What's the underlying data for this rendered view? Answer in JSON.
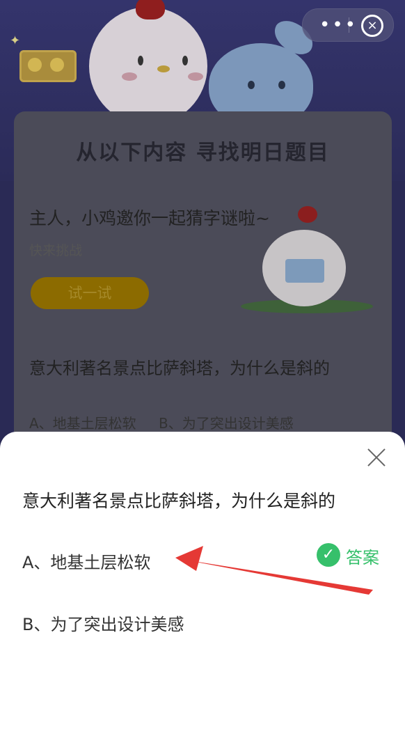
{
  "header": {
    "title": "从以下内容 寻找明日题目"
  },
  "promo": {
    "text": "主人，小鸡邀你一起猜字谜啦~",
    "subtext": "快来挑战",
    "button_label": "试一试"
  },
  "background_question": {
    "text": "意大利著名景点比萨斜塔，为什么是斜的",
    "option_a": "A、地基土层松软",
    "option_b": "B、为了突出设计美感"
  },
  "sheet": {
    "question": "意大利著名景点比萨斜塔，为什么是斜的",
    "options": [
      {
        "label": "A、地基土层松软"
      },
      {
        "label": "B、为了突出设计美感"
      }
    ],
    "answer_label": "答案"
  },
  "colors": {
    "answer_green": "#36c06b",
    "arrow_red": "#e53935"
  }
}
